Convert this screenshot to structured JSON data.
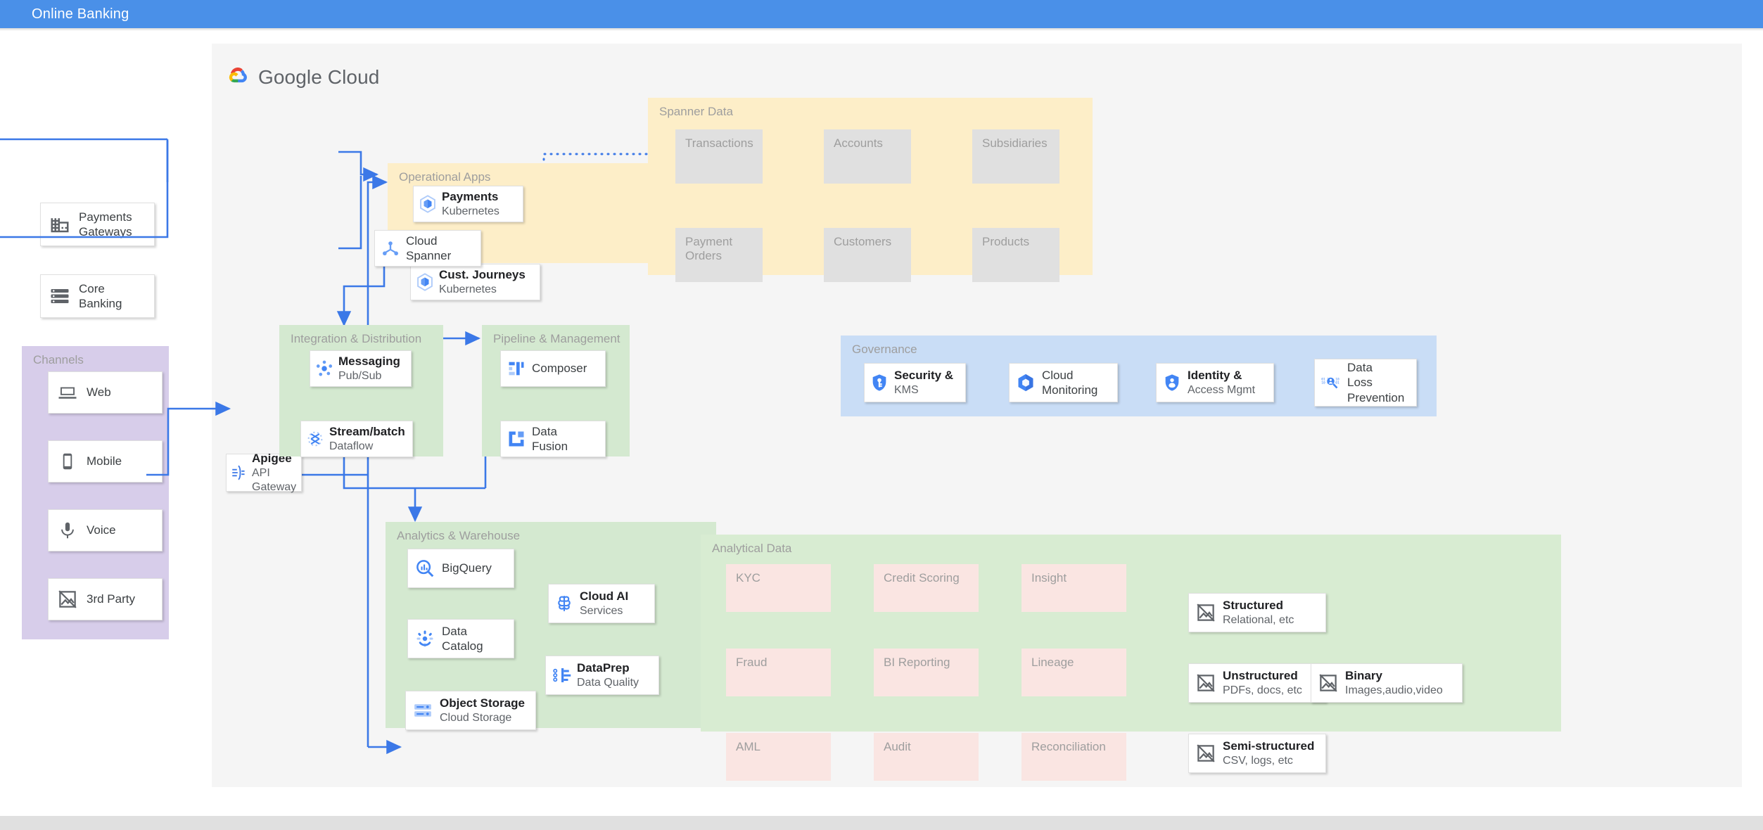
{
  "appbar": {
    "title": "Online Banking"
  },
  "brand": {
    "name_bold": "Google",
    "name_light": "Cloud"
  },
  "colors": {
    "appbar": "#4a90e8",
    "canvas": "#f5f5f5",
    "operational_apps": "#fdeec8",
    "spanner_data": "#fdeec8",
    "integration": "#d4e9d0",
    "pipeline": "#d4e9d0",
    "analytics": "#d4e9d0",
    "analytical_data": "#d8ecd2",
    "governance": "#c9ddf6",
    "channels": "#d7cdea",
    "tile_grey": "#e0e0e0",
    "tile_pink": "#fae5e2",
    "arrow_blue": "#3b78e7"
  },
  "external": {
    "payments_gateways": {
      "title": "Payments",
      "subtitle": "Gateways",
      "icon": "building-icon"
    },
    "core_banking": {
      "title": "Core",
      "subtitle": "Banking",
      "icon": "server-stack-icon"
    }
  },
  "channels": {
    "title": "Channels",
    "items": [
      {
        "label": "Web",
        "icon": "laptop-icon"
      },
      {
        "label": "Mobile",
        "icon": "phone-icon"
      },
      {
        "label": "Voice",
        "icon": "microphone-icon"
      },
      {
        "label": "3rd Party",
        "icon": "broken-image-icon"
      }
    ]
  },
  "apigee": {
    "title": "Apigee",
    "subtitle": "API Gateway",
    "icon": "apigee-icon"
  },
  "operational_apps": {
    "title": "Operational Apps",
    "items": [
      {
        "title": "Payments",
        "subtitle": "Kubernetes",
        "icon": "kubernetes-engine-icon"
      },
      {
        "title": "Cust. Journeys",
        "subtitle": "Kubernetes",
        "icon": "kubernetes-engine-icon"
      }
    ],
    "spanner": {
      "title": "Cloud",
      "subtitle": "Spanner",
      "icon": "cloud-spanner-icon"
    }
  },
  "spanner_data": {
    "title": "Spanner Data",
    "tiles": [
      "Transactions",
      "Accounts",
      "Subsidiaries",
      "Payment Orders",
      "Customers",
      "Products"
    ]
  },
  "integration": {
    "title": "Integration & Distribution",
    "items": [
      {
        "title": "Messaging",
        "subtitle": "Pub/Sub",
        "icon": "pubsub-icon"
      },
      {
        "title": "Stream/batch",
        "subtitle": "Dataflow",
        "icon": "dataflow-icon"
      }
    ]
  },
  "pipeline": {
    "title": "Pipeline & Management",
    "items": [
      {
        "title": "Composer",
        "subtitle": "",
        "icon": "composer-icon"
      },
      {
        "title": "Data",
        "subtitle": "Fusion",
        "icon": "data-fusion-icon"
      }
    ]
  },
  "governance": {
    "title": "Governance",
    "items": [
      {
        "title": "Security &",
        "subtitle": "KMS",
        "icon": "key-management-icon"
      },
      {
        "title": "Cloud",
        "subtitle": "Monitoring",
        "icon": "cloud-monitoring-icon"
      },
      {
        "title": "Identity &",
        "subtitle": "Access Mgmt",
        "icon": "identity-access-icon"
      },
      {
        "title": "Data",
        "subtitle": "Loss",
        "subtitle2": "Prevention",
        "icon": "data-loss-prevention-icon"
      }
    ]
  },
  "analytics": {
    "title": "Analytics & Warehouse",
    "items": [
      {
        "title": "BigQuery",
        "subtitle": "",
        "icon": "bigquery-icon"
      },
      {
        "title": "Data",
        "subtitle": "Catalog",
        "icon": "data-catalog-icon"
      },
      {
        "title": "Object Storage",
        "subtitle": "Cloud Storage",
        "icon": "cloud-storage-icon"
      },
      {
        "title": "Cloud AI",
        "subtitle": "Services",
        "icon": "cloud-ai-icon"
      },
      {
        "title": "DataPrep",
        "subtitle": "Data Quality",
        "icon": "dataprep-icon"
      }
    ]
  },
  "analytical_data": {
    "title": "Analytical Data",
    "tiles": [
      "KYC",
      "Credit Scoring",
      "Insight",
      "Fraud",
      "BI Reporting",
      "Lineage",
      "AML",
      "Audit",
      "Reconciliation"
    ],
    "types": [
      {
        "title": "Structured",
        "subtitle": "Relational, etc",
        "icon": "broken-image-icon"
      },
      {
        "title": "Unstructured",
        "subtitle": "PDFs, docs, etc",
        "icon": "broken-image-icon"
      },
      {
        "title": "Semi-structured",
        "subtitle": "CSV, logs, etc",
        "icon": "broken-image-icon"
      },
      {
        "title": "Binary",
        "subtitle": "Images,audio,video",
        "icon": "broken-image-icon"
      }
    ]
  }
}
